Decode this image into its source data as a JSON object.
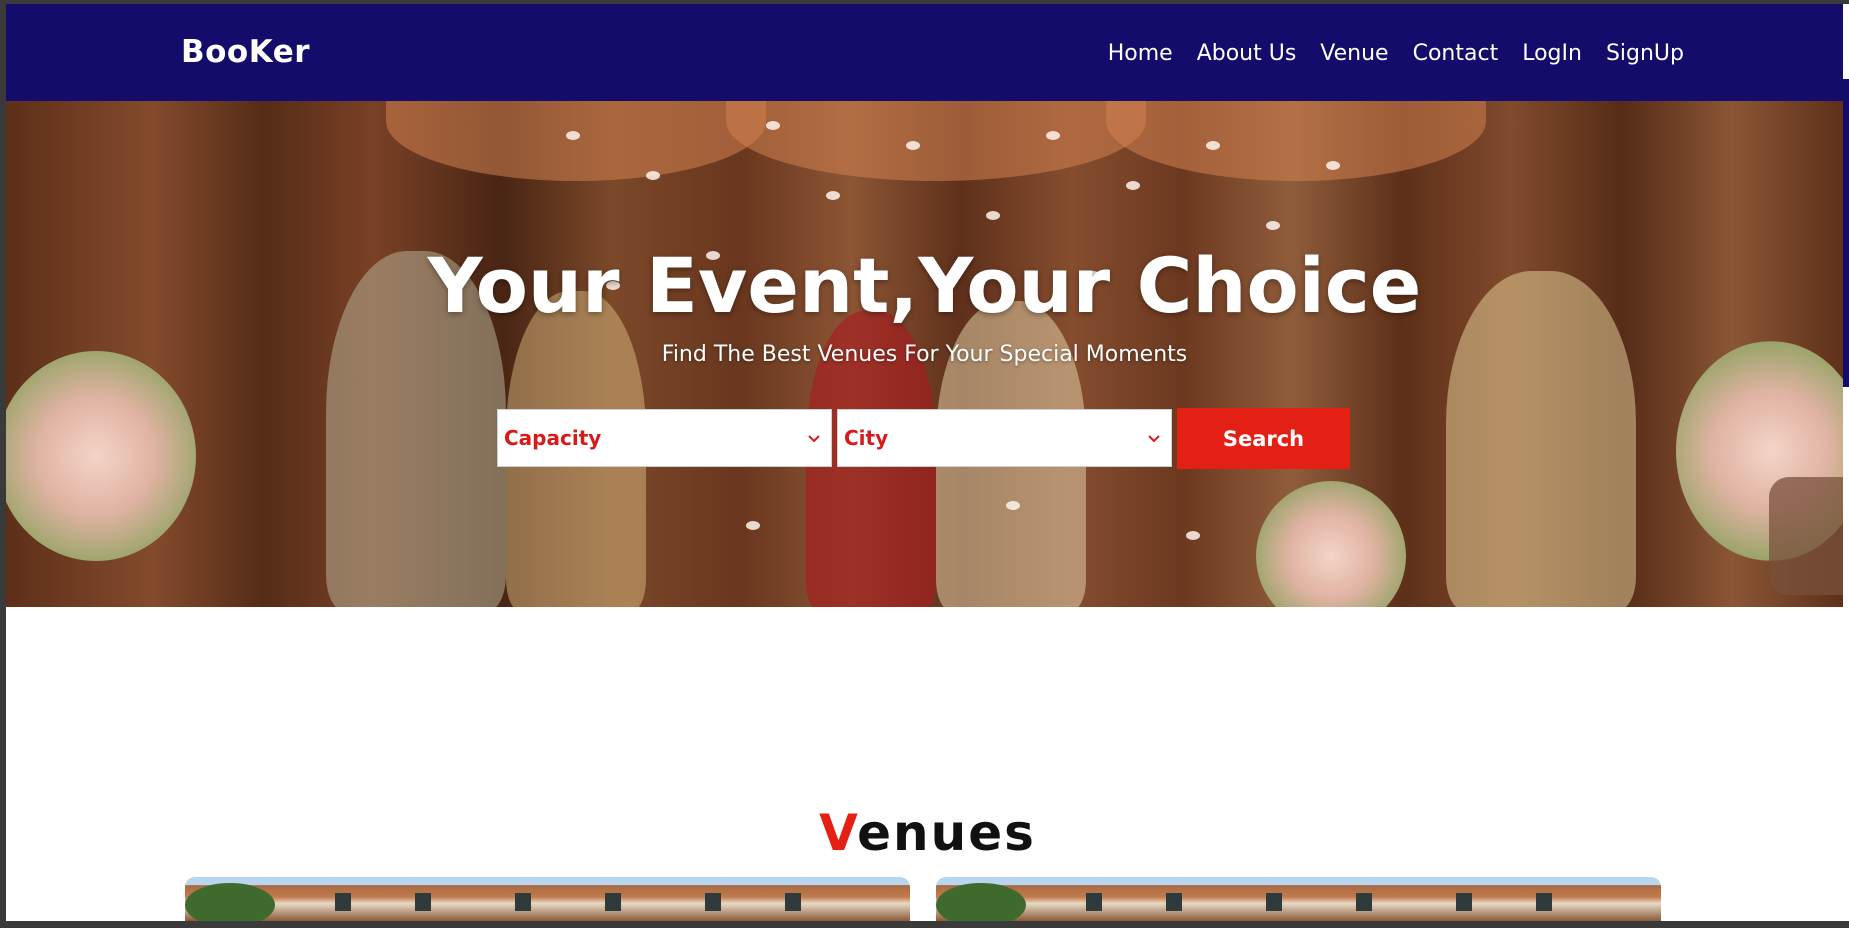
{
  "brand": {
    "name": "BooKer"
  },
  "nav": {
    "items": [
      {
        "label": "Home"
      },
      {
        "label": "About Us"
      },
      {
        "label": "Venue"
      },
      {
        "label": "Contact"
      },
      {
        "label": "LogIn"
      },
      {
        "label": "SignUp"
      }
    ]
  },
  "hero": {
    "title": "Your Event,Your Choice",
    "subtitle": "Find The Best Venues For Your Special Moments",
    "capacity_select": {
      "selected": "Capacity",
      "icon": "chevron-down-icon"
    },
    "city_select": {
      "selected": "City",
      "icon": "chevron-down-icon"
    },
    "search_label": "Search"
  },
  "venues": {
    "heading_accent": "V",
    "heading_rest": "enues"
  },
  "colors": {
    "navbar": "#130c6a",
    "accent": "#e41f14",
    "text_white": "#ffffff"
  }
}
